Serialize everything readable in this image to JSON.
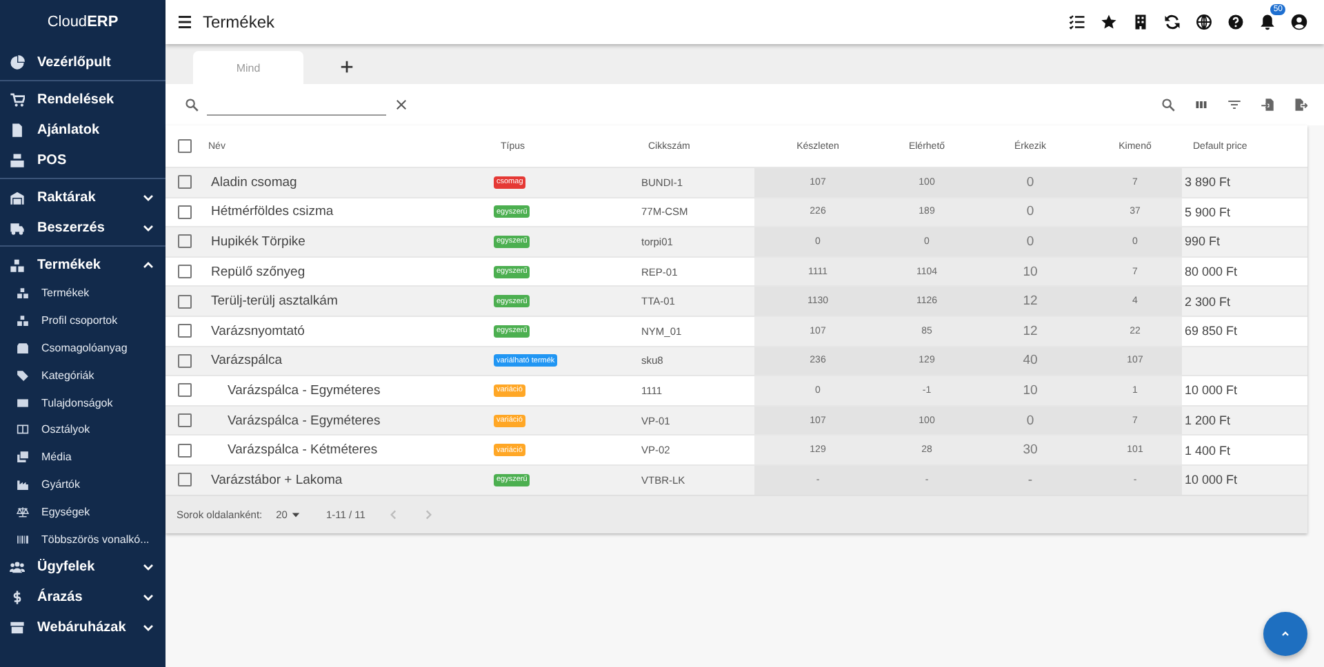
{
  "sidebar": {
    "logo": {
      "plain": "Cloud",
      "bold": "ERP"
    },
    "groups": [
      [
        {
          "label": "Vezérlőpult",
          "kind": "link"
        }
      ],
      [
        {
          "label": "Rendelések",
          "kind": "link"
        },
        {
          "label": "Ajánlatok",
          "kind": "link"
        },
        {
          "label": "POS",
          "kind": "link"
        }
      ],
      [
        {
          "label": "Raktárak",
          "kind": "group",
          "expanded": false
        },
        {
          "label": "Beszerzés",
          "kind": "group",
          "expanded": false
        }
      ],
      [
        {
          "label": "Termékek",
          "kind": "group",
          "expanded": true,
          "children": [
            {
              "label": "Termékek"
            },
            {
              "label": "Profil csoportok"
            },
            {
              "label": "Csomagolóanyag"
            },
            {
              "label": "Kategóriák"
            },
            {
              "label": "Tulajdonságok"
            },
            {
              "label": "Osztályok"
            },
            {
              "label": "Média"
            },
            {
              "label": "Gyártók"
            },
            {
              "label": "Egységek"
            },
            {
              "label": "Többszörös vonalkó..."
            }
          ]
        },
        {
          "label": "Ügyfelek",
          "kind": "group",
          "expanded": false
        },
        {
          "label": "Árazás",
          "kind": "group",
          "expanded": false
        },
        {
          "label": "Webáruházak",
          "kind": "group",
          "expanded": false
        }
      ]
    ]
  },
  "topbar": {
    "title": "Termékek",
    "notification_count": "50"
  },
  "tabs": [
    {
      "label": "Mind",
      "selected": true
    }
  ],
  "table": {
    "all_checked": false,
    "columns": [
      "Név",
      "Típus",
      "Cikkszám",
      "Készleten",
      "Elérhető",
      "Érkezik",
      "Kimenő",
      "Default price"
    ],
    "rows": [
      {
        "name": "Aladin csomag",
        "type": {
          "label": "csomag",
          "color": "#e53935"
        },
        "sku": "BUNDI-1",
        "stock": "107",
        "available": "100",
        "incoming": "0",
        "outgoing": "7",
        "price": "3 890 Ft",
        "checked": false
      },
      {
        "name": "Hétmérföldes csizma",
        "type": {
          "label": "egyszerű",
          "color": "#4caf50"
        },
        "sku": "77M-CSM",
        "stock": "226",
        "available": "189",
        "incoming": "0",
        "outgoing": "37",
        "price": "5 900 Ft",
        "checked": false
      },
      {
        "name": "Hupikék Törpike",
        "type": {
          "label": "egyszerű",
          "color": "#4caf50"
        },
        "sku": "torpi01",
        "stock": "0",
        "available": "0",
        "incoming": "0",
        "outgoing": "0",
        "price": "990 Ft",
        "checked": false
      },
      {
        "name": "Repülő szőnyeg",
        "type": {
          "label": "egyszerű",
          "color": "#4caf50"
        },
        "sku": "REP-01",
        "stock": "1111",
        "available": "1104",
        "incoming": "10",
        "outgoing": "7",
        "price": "80 000 Ft",
        "checked": false
      },
      {
        "name": "Terülj-terülj asztalkám",
        "type": {
          "label": "egyszerű",
          "color": "#4caf50"
        },
        "sku": "TTA-01",
        "stock": "1130",
        "available": "1126",
        "incoming": "12",
        "outgoing": "4",
        "price": "2 300 Ft",
        "checked": false
      },
      {
        "name": "Varázsnyomtató",
        "type": {
          "label": "egyszerű",
          "color": "#4caf50"
        },
        "sku": "NYM_01",
        "stock": "107",
        "available": "85",
        "incoming": "12",
        "outgoing": "22",
        "price": "69 850 Ft",
        "checked": false
      },
      {
        "name": "Varázspálca",
        "type": {
          "label": "variálható termék",
          "color": "#2196f3"
        },
        "sku": "sku8",
        "stock": "236",
        "available": "129",
        "incoming": "40",
        "outgoing": "107",
        "checked": false,
        "children": [
          {
            "name": "Varázspálca - Egyméteres",
            "type": {
              "label": "variáció",
              "color": "#ffa726"
            },
            "sku": "1111",
            "stock": "0",
            "available": "-1",
            "incoming": "10",
            "outgoing": "1",
            "price": "10 000 Ft",
            "checked": false
          },
          {
            "name": "Varázspálca - Egyméteres",
            "type": {
              "label": "variáció",
              "color": "#ffa726"
            },
            "sku": "VP-01",
            "stock": "107",
            "available": "100",
            "incoming": "0",
            "outgoing": "7",
            "price": "1 200 Ft",
            "checked": false
          },
          {
            "name": "Varázspálca - Kétméteres",
            "type": {
              "label": "variáció",
              "color": "#ffa726"
            },
            "sku": "VP-02",
            "stock": "129",
            "available": "28",
            "incoming": "30",
            "outgoing": "101",
            "price": "1 400 Ft",
            "checked": false
          }
        ]
      },
      {
        "name": "Varázstábor + Lakoma",
        "type": {
          "label": "egyszerű",
          "color": "#4caf50"
        },
        "sku": "VTBR-LK",
        "stock": "-",
        "available": "-",
        "incoming": "-",
        "outgoing": "-",
        "price": "10 000 Ft",
        "checked": false
      }
    ]
  },
  "pagination": {
    "label": "Sorok oldalanként:",
    "per_page": "20",
    "range": "1-11 / 11",
    "prev_disabled": true,
    "next_disabled": true
  }
}
